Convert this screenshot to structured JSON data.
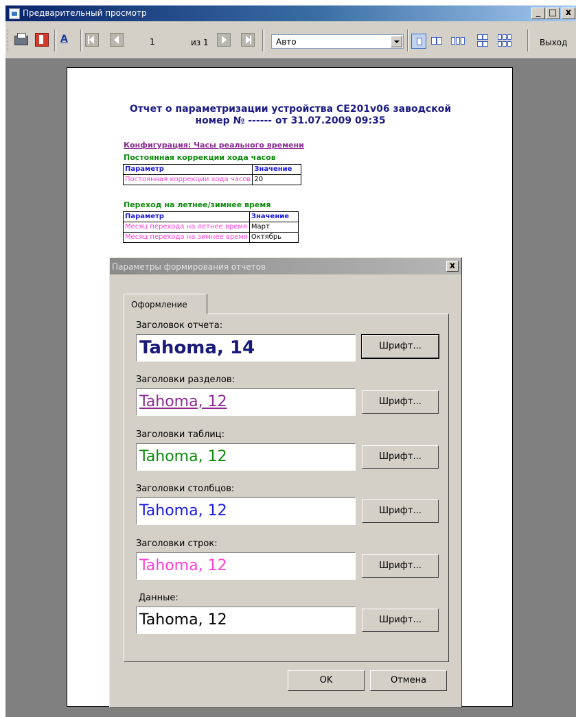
{
  "window": {
    "title": "Предварительный просмотр",
    "minimize": "_",
    "maximize": "□",
    "close": "x"
  },
  "toolbar": {
    "print_icon": "printer-icon",
    "book_icon": "book-icon",
    "font_icon_label": "A",
    "page_number": "1",
    "of_label": "из 1",
    "zoom_value": "Авто",
    "exit_label": "Выход"
  },
  "report": {
    "title_line1": "Отчет  о параметризации устройства СЕ201v06 заводской",
    "title_line2": "номер № ------ от 31.07.2009 09:35",
    "section_title": "Конфигурация:  Часы реального времени",
    "tables": [
      {
        "title": "Постоянная коррекции хода часов",
        "header": [
          "Параметр",
          "Значение"
        ],
        "rows": [
          [
            "Постоянная коррекции хода часов",
            "20"
          ]
        ]
      },
      {
        "title": "Переход на летнее/зимнее время",
        "header": [
          "Параметр",
          "Значение"
        ],
        "rows": [
          [
            "Месяц перехода на летнее время",
            "Март"
          ],
          [
            "Месяц перехода на зимнее время",
            "Октябрь"
          ]
        ]
      }
    ]
  },
  "dialog": {
    "title": "Параметры формирования отчетов",
    "close": "x",
    "tab_label": "Оформление",
    "fields": [
      {
        "label": "Заголовок отчета:",
        "value": "Tahoma, 14",
        "color": "#1a1a7a",
        "button": "Шрифт..."
      },
      {
        "label": "Заголовки разделов:",
        "value": "Tahoma, 12",
        "color": "#8b2c93",
        "button": "Шрифт..."
      },
      {
        "label": "Заголовки таблиц:",
        "value": "Tahoma, 12",
        "color": "#0c8a0c",
        "button": "Шрифт..."
      },
      {
        "label": "Заголовки столбцов:",
        "value": "Tahoma, 12",
        "color": "#1818e6",
        "button": "Шрифт..."
      },
      {
        "label": "Заголовки строк:",
        "value": "Tahoma, 12",
        "color": "#ff3fd6",
        "button": "Шрифт..."
      },
      {
        "label": "Данные:",
        "value": "Tahoma, 12",
        "color": "#000000",
        "button": "Шрифт..."
      }
    ],
    "ok_label": "OK",
    "cancel_label": "Отмена"
  }
}
